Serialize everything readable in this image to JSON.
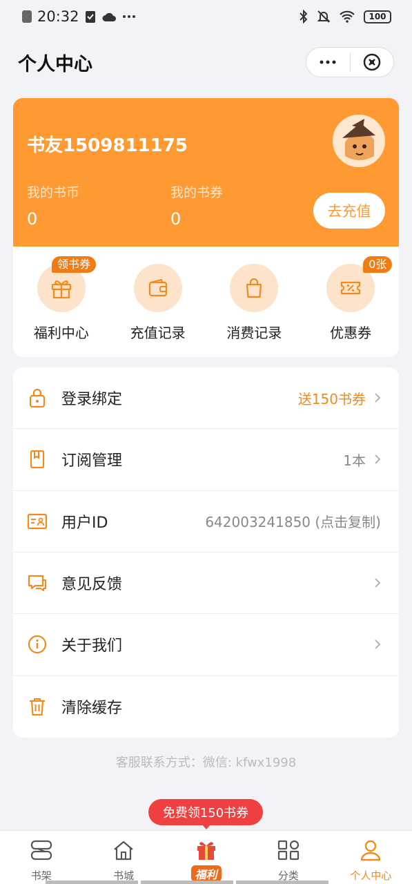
{
  "status_bar": {
    "time": "20:32",
    "battery": "100"
  },
  "header": {
    "title": "个人中心"
  },
  "profile": {
    "username": "书友1509811175",
    "coins_label": "我的书币",
    "coins_value": "0",
    "vouchers_label": "我的书券",
    "vouchers_value": "0",
    "recharge_label": "去充值"
  },
  "shortcuts": [
    {
      "label": "福利中心",
      "badge": "领书券",
      "icon": "gift-icon"
    },
    {
      "label": "充值记录",
      "icon": "wallet-icon"
    },
    {
      "label": "消费记录",
      "icon": "shopping-bag-icon"
    },
    {
      "label": "优惠券",
      "badge": "0张",
      "icon": "coupon-icon"
    }
  ],
  "menu": [
    {
      "label": "登录绑定",
      "value": "送150书券",
      "icon": "lock-icon"
    },
    {
      "label": "订阅管理",
      "value": "1本",
      "icon": "bookmark-icon"
    },
    {
      "label": "用户ID",
      "value": "642003241850 (点击复制)",
      "icon": "id-card-icon"
    },
    {
      "label": "意见反馈",
      "value": "",
      "icon": "chat-icon"
    },
    {
      "label": "关于我们",
      "value": "",
      "icon": "info-icon"
    },
    {
      "label": "清除缓存",
      "value": "",
      "icon": "trash-icon"
    }
  ],
  "contact": "客服联系方式：微信: kfwx1998",
  "promo": "免费领150书券",
  "tabs": [
    {
      "label": "书架",
      "icon": "bookshelf-icon"
    },
    {
      "label": "书城",
      "icon": "home-icon"
    },
    {
      "label": "福利",
      "icon": "gift-icon"
    },
    {
      "label": "分类",
      "icon": "grid-icon"
    },
    {
      "label": "个人中心",
      "icon": "user-icon"
    }
  ],
  "colors": {
    "accent": "#ff9a33",
    "badge": "#f07d14",
    "promo": "#ef4141"
  }
}
